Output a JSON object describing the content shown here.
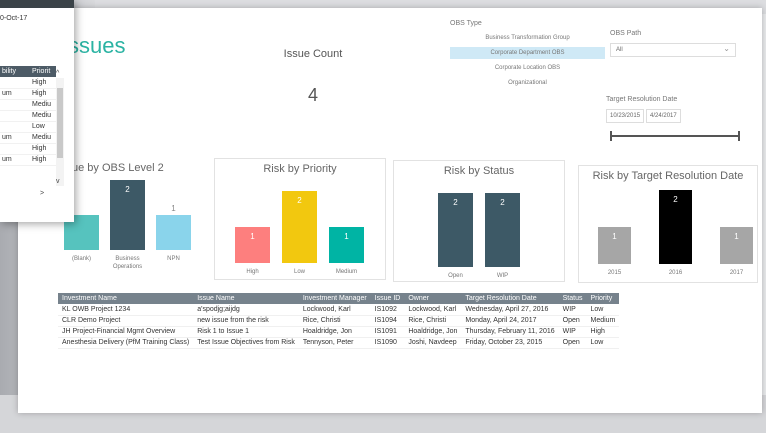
{
  "report": {
    "title": "ssues",
    "issue_count_label": "Issue Count",
    "issue_count_value": "4"
  },
  "obs_type": {
    "header": "OBS Type",
    "options": [
      "Business Transformation Group",
      "Corporate Department OBS",
      "Corporate Location OBS",
      "Organizational"
    ],
    "selected_index": 1
  },
  "obs_path": {
    "header": "OBS Path",
    "value": "All"
  },
  "target_date": {
    "header": "Target Resolution Date",
    "from": "10/23/2015",
    "to": "4/24/2017"
  },
  "popup": {
    "date": "0-Oct-17",
    "columns": [
      "bility",
      "Priorit"
    ],
    "rows": [
      [
        "",
        "High"
      ],
      [
        "um",
        "High"
      ],
      [
        "",
        "Mediu"
      ],
      [
        "",
        "Mediu"
      ],
      [
        "",
        "Low"
      ],
      [
        "um",
        "Mediu"
      ],
      [
        "",
        "High"
      ],
      [
        "um",
        "High"
      ]
    ]
  },
  "colors": {
    "obs_dark": "#3d5966",
    "obs_light": "#8ad4eb",
    "obs_partial": "#56c3be",
    "priority_high": "#fd7f7e",
    "priority_low": "#f2c80f",
    "priority_medium": "#00b4a4",
    "status": "#3d5966",
    "year_grey": "#a6a6a6",
    "year_black": "#000000"
  },
  "chart_data": [
    {
      "type": "bar",
      "title": "ue by OBS Level 2",
      "categories": [
        "(Blank)",
        "Business Operations",
        "NPN"
      ],
      "values": [
        1,
        2,
        1
      ],
      "data_labels": [
        "",
        "2",
        "1"
      ]
    },
    {
      "type": "bar",
      "title": "Risk by Priority",
      "categories": [
        "High",
        "Low",
        "Medium"
      ],
      "values": [
        1,
        2,
        1
      ]
    },
    {
      "type": "bar",
      "title": "Risk by Status",
      "categories": [
        "Open",
        "WIP"
      ],
      "values": [
        2,
        2
      ]
    },
    {
      "type": "bar",
      "title": "Risk by Target Resolution Date",
      "categories": [
        "2015",
        "2016",
        "2017"
      ],
      "values": [
        1,
        2,
        1
      ]
    }
  ],
  "table": {
    "columns": [
      "Investment Name",
      "Issue Name",
      "Investment Manager",
      "Issue ID",
      "Owner",
      "Target Resolution Date",
      "Status",
      "Priority"
    ],
    "rows": [
      [
        "KL OWB Project 1234",
        "a'spodjg;aijdg",
        "Lockwood, Karl",
        "IS1092",
        "Lockwood, Karl",
        "Wednesday, April 27, 2016",
        "WIP",
        "Low"
      ],
      [
        "CLR Demo Project",
        "new issue from the risk",
        "Rice, Christi",
        "IS1094",
        "Rice, Christi",
        "Monday, April 24, 2017",
        "Open",
        "Medium"
      ],
      [
        "JH Project-Financial Mgmt Overview",
        "Risk 1 to Issue 1",
        "Hoaldridge, Jon",
        "IS1091",
        "Hoaldridge, Jon",
        "Thursday, February 11, 2016",
        "WIP",
        "High"
      ],
      [
        "Anesthesia Delivery  (PfM Training Class)",
        "Test Issue Objectives from Risk",
        "Tennyson, Peter",
        "IS1090",
        "Joshi, Navdeep",
        "Friday, October 23, 2015",
        "Open",
        "Low"
      ]
    ]
  }
}
